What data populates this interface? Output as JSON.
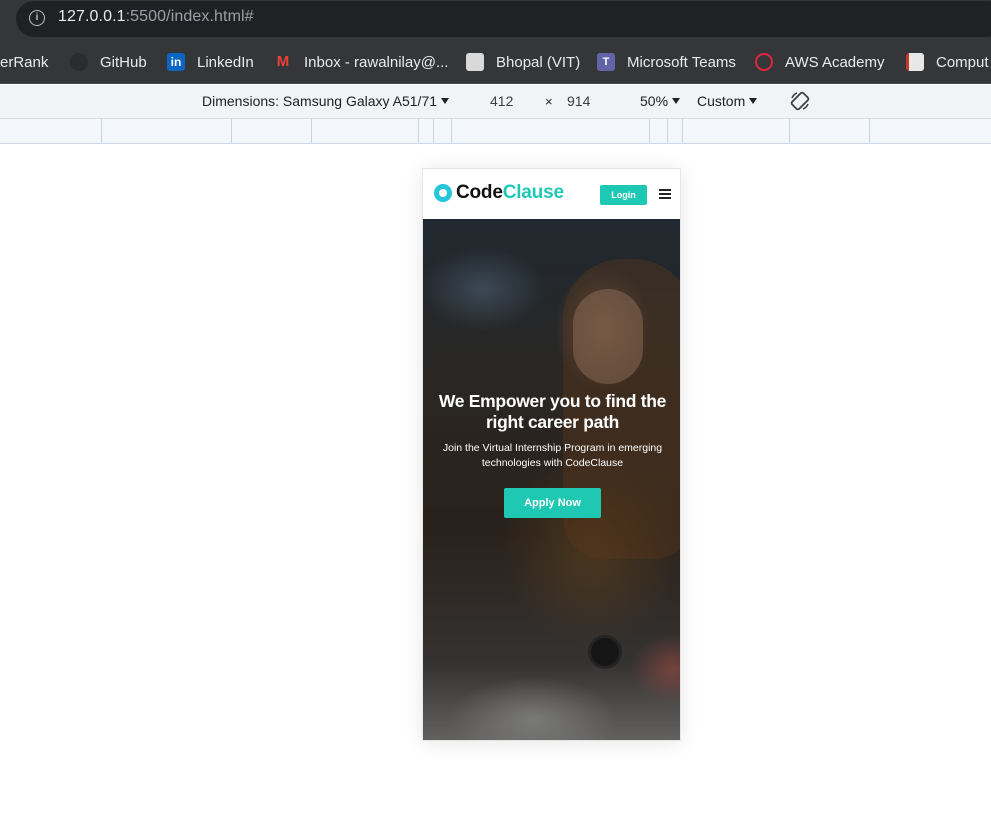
{
  "browser": {
    "url_host": "127.0.0.1",
    "url_path": ":5500/index.html#"
  },
  "bookmarks": [
    {
      "label": "erRank",
      "icon": "hackerrank-icon"
    },
    {
      "label": "GitHub",
      "icon": "github-icon"
    },
    {
      "label": "LinkedIn",
      "icon": "linkedin-icon",
      "color": "#0a66c2"
    },
    {
      "label": "Inbox - rawalnilay@...",
      "icon": "gmail-icon",
      "color": "#ea4335"
    },
    {
      "label": "Bhopal (VIT)",
      "icon": "vit-icon"
    },
    {
      "label": "Microsoft Teams",
      "icon": "teams-icon",
      "color": "#6264a7"
    },
    {
      "label": "AWS Academy",
      "icon": "aws-academy-icon",
      "color": "#e0263c"
    },
    {
      "label": "Comput",
      "icon": "book-icon"
    }
  ],
  "device_toolbar": {
    "dimensions_label": "Dimensions: Samsung Galaxy A51/71",
    "width": "412",
    "times": "×",
    "height": "914",
    "zoom": "50%",
    "throttle": "Custom"
  },
  "site": {
    "logo_code": "Code",
    "logo_clause": "Clause",
    "login_label": "Login",
    "hero_title": "We Empower you to find the right career path",
    "hero_subtitle": "Join the Virtual Internship Program in emerging technologies with CodeClause",
    "apply_label": "Apply Now",
    "accent_color": "#1fc8b2"
  }
}
